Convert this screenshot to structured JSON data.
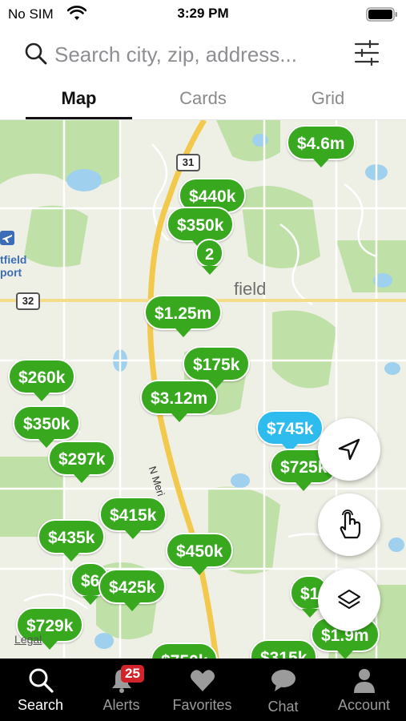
{
  "status_bar": {
    "carrier": "No SIM",
    "time": "3:29 PM"
  },
  "search": {
    "placeholder": "Search city, zip, address..."
  },
  "tabs": [
    {
      "label": "Map",
      "active": true
    },
    {
      "label": "Cards",
      "active": false
    },
    {
      "label": "Grid",
      "active": false
    }
  ],
  "map": {
    "place_label": "field",
    "airport_label_line1": "tfield",
    "airport_label_line2": "port",
    "street_label": "N Meri",
    "legal": "Legal",
    "route_shields": [
      "31",
      "32"
    ],
    "pins": [
      {
        "price": "$4.6m"
      },
      {
        "price": "$440k"
      },
      {
        "price": "$350k"
      },
      {
        "price": "2"
      },
      {
        "price": "$1.25m"
      },
      {
        "price": "$175k"
      },
      {
        "price": "$260k"
      },
      {
        "price": "$3.12m"
      },
      {
        "price": "$350k"
      },
      {
        "price": "$745k",
        "selected": true
      },
      {
        "price": "$297k"
      },
      {
        "price": "$725k"
      },
      {
        "price": "$415k"
      },
      {
        "price": "$435k"
      },
      {
        "price": "$450k"
      },
      {
        "price": "$425k"
      },
      {
        "price": "$6"
      },
      {
        "price": "$1"
      },
      {
        "price": "$729k"
      },
      {
        "price": "$1.9m"
      },
      {
        "price": "$750k"
      },
      {
        "price": "$315k"
      }
    ]
  },
  "floating_buttons": [
    "location-arrow-icon",
    "draw-hand-icon",
    "layers-icon"
  ],
  "colors": {
    "pin_green": "#38a81f",
    "pin_selected": "#2ebcef",
    "tab_bar": "#000000",
    "badge": "#d2232a"
  },
  "bottom_tabs": [
    {
      "label": "Search",
      "icon": "search-icon",
      "active": true
    },
    {
      "label": "Alerts",
      "icon": "bell-icon",
      "badge": "25"
    },
    {
      "label": "Favorites",
      "icon": "heart-icon"
    },
    {
      "label": "Chat",
      "icon": "chat-bubble-icon"
    },
    {
      "label": "Account",
      "icon": "person-icon"
    }
  ]
}
